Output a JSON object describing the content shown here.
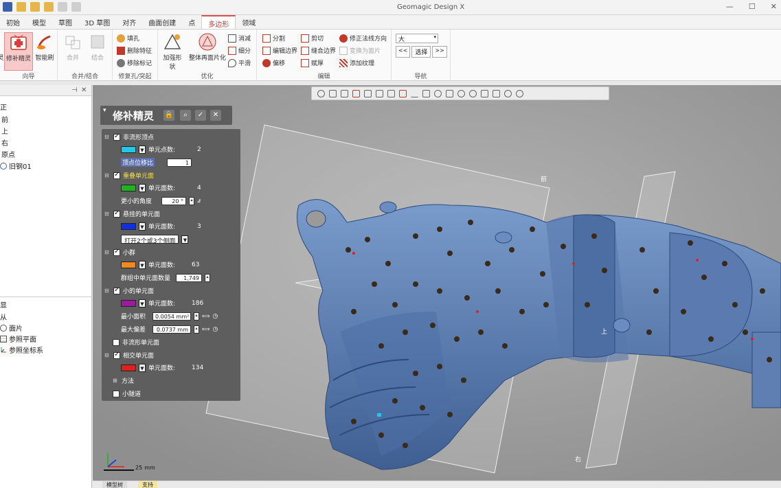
{
  "app": {
    "title": "Geomagic Design X"
  },
  "window_controls": [
    "—",
    "☐",
    "✕"
  ],
  "ribbon_tabs": [
    {
      "label": "初始",
      "active": false
    },
    {
      "label": "模型",
      "active": false
    },
    {
      "label": "草图",
      "active": false
    },
    {
      "label": "3D 草图",
      "active": false
    },
    {
      "label": "对齐",
      "active": false
    },
    {
      "label": "曲面创建",
      "active": false
    },
    {
      "label": "点",
      "active": false
    },
    {
      "label": "多边形",
      "active": true
    },
    {
      "label": "领域",
      "active": false
    }
  ],
  "ribbon": {
    "guide": {
      "label": "向导",
      "btn_cut": "灵",
      "btn_repair": "修补精灵",
      "btn_brush": "智能刷"
    },
    "merge": {
      "label": "合并/结合",
      "btn_merge": "合并",
      "btn_combine": "结合"
    },
    "fill": {
      "label": "修复孔/突起",
      "btn_fill": "填孔",
      "btn_remove_feature": "删除特征",
      "btn_remove_marker": "移除标记"
    },
    "optimize": {
      "label": "优化",
      "btn_shape": "加强形状",
      "btn_global": "整体再面片化",
      "btn_decimate": "消减",
      "btn_subdivide": "细分",
      "btn_smooth": "平滑"
    },
    "edit": {
      "label": "编辑",
      "btn_split": "分割",
      "btn_trim": "剪切",
      "btn_fix_normal": "修正法线方向",
      "btn_edit_boundary": "编辑边界",
      "btn_merge_boundary": "缝合边界",
      "btn_convert": "变换为面片",
      "btn_offset": "偏移",
      "btn_thicken": "赋厚",
      "btn_texture": "添加纹理"
    },
    "nav": {
      "label": "导航",
      "select_value": "大",
      "prev": "<<",
      "select_label": "选择",
      "next": ">>"
    }
  },
  "left_panel": {
    "tree_items": [
      "正",
      "前",
      "上",
      "右",
      "原点",
      "旧钢01"
    ],
    "lower_header": "显",
    "lower_items": [
      "从",
      "面片",
      "参照平面",
      "参照坐标系"
    ]
  },
  "wizard": {
    "title": "修补精灵",
    "sections": [
      {
        "name": "非流形顶点",
        "checked": true,
        "color": "#22c8e6",
        "count_label": "单元点数:",
        "count": "2",
        "param_label": "顶点位移比",
        "param_value": "1"
      },
      {
        "name": "重叠单元面",
        "checked": true,
        "color": "#1fb31f",
        "count_label": "单元面数:",
        "count": "4",
        "param_label": "更小的角度",
        "param_value": "20 °"
      },
      {
        "name": "悬挂的单元面",
        "checked": true,
        "color": "#1030e0",
        "count_label": "单元面数:",
        "count": "3",
        "param_value": "打开2个或3个侧面"
      },
      {
        "name": "小群",
        "checked": true,
        "color": "#f08a1c",
        "count_label": "单元面数:",
        "count": "63",
        "param_label": "群组中单元面数量",
        "param_value": "1,749"
      },
      {
        "name": "小的单元面",
        "checked": true,
        "color": "#9b1b9b",
        "count_label": "单元面数:",
        "count": "186",
        "param_label": "最小面积",
        "param_value": "0.0054 mm²",
        "param2_label": "最大偏差",
        "param2_value": "0.0737 mm"
      },
      {
        "name": "非流形单元面",
        "checked": false
      },
      {
        "name": "相交单元面",
        "checked": true,
        "color": "#e02020",
        "count_label": "单元面数:",
        "count": "134"
      }
    ],
    "method_label": "方法",
    "tunnel_label": "小隧道"
  },
  "viewport": {
    "plane_labels": {
      "front": "前",
      "top": "上",
      "right": "右"
    },
    "scale_label": "25",
    "scale_unit": "mm"
  },
  "status_tabs": [
    "模型树",
    "支持"
  ]
}
